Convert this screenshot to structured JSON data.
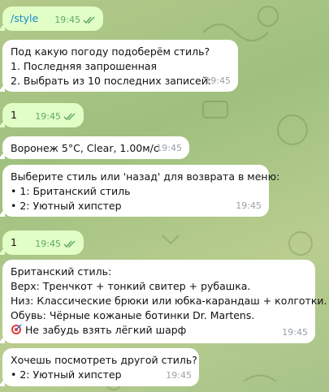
{
  "colors": {
    "incoming_bubble": "#ffffff",
    "outgoing_bubble": "#e1fec6",
    "timestamp_out": "#5fa86a",
    "link": "#168acd"
  },
  "messages": [
    {
      "direction": "out",
      "lines": [
        "/style"
      ],
      "time": "19:45",
      "status": "read"
    },
    {
      "direction": "in",
      "lines": [
        "Под какую погоду подоберём стиль?",
        "1. Последняя запрошенная",
        "2. Выбрать из 10 последних записей:"
      ],
      "time": "19:45"
    },
    {
      "direction": "out",
      "lines": [
        "1"
      ],
      "time": "19:45",
      "status": "read"
    },
    {
      "direction": "in",
      "lines": [
        "Воронеж 5°C, Clear, 1.00м/с"
      ],
      "time": "19:45"
    },
    {
      "direction": "in",
      "lines": [
        "Выберите стиль или 'назад' для возврата в меню:",
        "• 1: Британский стиль",
        "• 2: Уютный хипстер"
      ],
      "time": "19:45"
    },
    {
      "direction": "out",
      "lines": [
        "1"
      ],
      "time": "19:45",
      "status": "read"
    },
    {
      "direction": "in",
      "lines": [
        "Британский стиль:",
        "Верх: Тренчкот + тонкий свитер + рубашка.",
        "Низ: Классические брюки или юбка-карандаш + колготки.",
        "Обувь: Чёрные кожаные ботинки Dr. Martens.",
        "Не забудь взять лёгкий шарф"
      ],
      "time": "19:45",
      "last_line_icon": "target-icon"
    },
    {
      "direction": "in",
      "lines": [
        "Хочешь посмотреть другой стиль?",
        "• 2: Уютный хипстер"
      ],
      "time": "19:45"
    }
  ]
}
